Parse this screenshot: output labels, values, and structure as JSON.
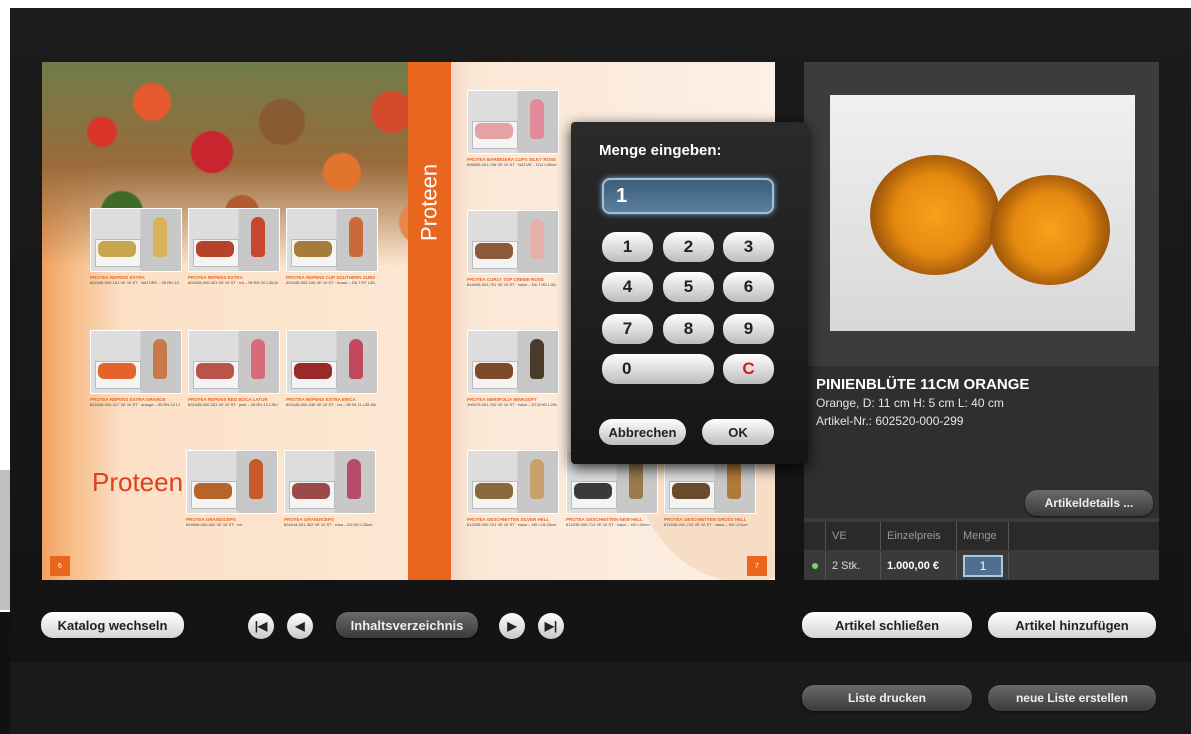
{
  "catalog": {
    "spine_title": "Proteen",
    "section_title": "Proteen",
    "left_page_number": "6",
    "right_page_number": "7",
    "left_products": [
      {
        "caption": "PROTEA REPENS EXTRA",
        "sub": "602445-000-101 VE 10 ST · NATURE – 05 RH-10 L35-50cm",
        "fill": "#c8a64a",
        "stem": "#d9b25a"
      },
      {
        "caption": "PROTEA REPENS EXTRA",
        "sub": "602445-000-401 VE 10 ST · rot – 05 RH-10 L35-50cm",
        "fill": "#b5432a",
        "stem": "#c9462c"
      },
      {
        "caption": "PROTEA REPENS CUP SOUTHERN SUNS",
        "sub": "602445-000-106 VE 10 ST · braun – D6-7 RT L35-45cm",
        "fill": "#a67c3a",
        "stem": "#c86a3a"
      },
      {
        "caption": "PROTEA REPENS EXTRA ORANGE",
        "sub": "602445-000-317 VE 10 ST · orange – 05 RH-12 L35-50cm",
        "fill": "#e5622a",
        "stem": "#c97a4a"
      },
      {
        "caption": "PROTEA REPENS RED BOCA LATUR",
        "sub": "602445-000-331 VE 10 ST · pink – 05 RH-13 L35-50cm",
        "fill": "#b8544a",
        "stem": "#d86a7a"
      },
      {
        "caption": "PROTEA REPENS EXTRA ERICA",
        "sub": "602445-000-336 VE 10 ST · rot – 06 05 11 L35-50cm",
        "fill": "#9a2a2a",
        "stem": "#c24a5a"
      },
      {
        "caption": "PROTEA GRANDICEPS",
        "sub": "604808-000-402 VE 15 ST · rot",
        "fill": "#b8632a",
        "stem": "#c65a2a"
      },
      {
        "caption": "PROTEA GRANDICEPS",
        "sub": "604244-001-302 VE 10 ST · rosa – D5 HD L25cm",
        "fill": "#9a4a4a",
        "stem": "#b84a6a"
      }
    ],
    "right_products": [
      {
        "caption": "PROTEA BARBIGERA CUPS SILKY ROSE",
        "sub": "606555-001-706 VE 10 ST · NATUR – D12 L35cm",
        "fill": "#e6a2a2",
        "stem": "#e28a9a"
      },
      {
        "caption": "PROTEA CURLY TOP CREME-ROSE",
        "sub": "604095-001-701 VE 10 ST · natur – D6-7 HD L35-40cm",
        "fill": "#8a5a3a",
        "stem": "#e4b0a8"
      },
      {
        "caption": "PROTEA NERIIFOLIA MINKSOFT",
        "sub": "190075-001-700 VE 10 ST · natur – D7-8 HD L20cm",
        "fill": "#7a4a2a",
        "stem": "#4a3a2a"
      },
      {
        "caption": "PROTEA GESCHNITTEN SILVER HELL",
        "sub": "612035-000-701 VE 10 ST · natur – HD L18-25cm",
        "fill": "#8a6a3a",
        "stem": "#c7a06a"
      },
      {
        "caption": "PROTEA GESCHNITTEN NEW HELL",
        "sub": "612035-000-713 VE 10 ST · natur – HD L20cm",
        "fill": "#3a3a3a",
        "stem": "#9a7a4a"
      },
      {
        "caption": "PROTEA GESCHNITTEN GROSS HELL",
        "sub": "612035-002-723 VE 10 ST · natur – HD L21cm",
        "fill": "#6a4a2a",
        "stem": "#b07a3a"
      }
    ]
  },
  "nav": {
    "switch_catalog": "Katalog wechseln",
    "toc": "Inhaltsverzeichnis",
    "first_icon": "skip-first-icon",
    "prev_icon": "prev-icon",
    "next_icon": "next-icon",
    "last_icon": "skip-last-icon"
  },
  "quantity_dialog": {
    "title": "Menge eingeben:",
    "value": "1",
    "keys": [
      "1",
      "2",
      "3",
      "4",
      "5",
      "6",
      "7",
      "8",
      "9",
      "0",
      "C"
    ],
    "cancel": "Abbrechen",
    "ok": "OK"
  },
  "product": {
    "title": "PINIENBLÜTE 11CM ORANGE",
    "description": "Orange, D: 11 cm H: 5 cm L: 40 cm",
    "article_no": "Artikel-Nr.: 602520-000-299",
    "details_button": "Artikeldetails ...",
    "table": {
      "headers": [
        "VE",
        "Einzelpreis",
        "Menge"
      ],
      "row": {
        "ve": "2 Stk.",
        "price": "1.000,00 €",
        "qty": "1"
      }
    },
    "close_button": "Artikel schließen",
    "add_button": "Artikel hinzufügen"
  },
  "list": {
    "print": "Liste drucken",
    "new": "neue Liste erstellen"
  },
  "colors": {
    "accent": "#e9661f",
    "qty_field": "#4e6f8f",
    "clear_key": "#d02020"
  }
}
